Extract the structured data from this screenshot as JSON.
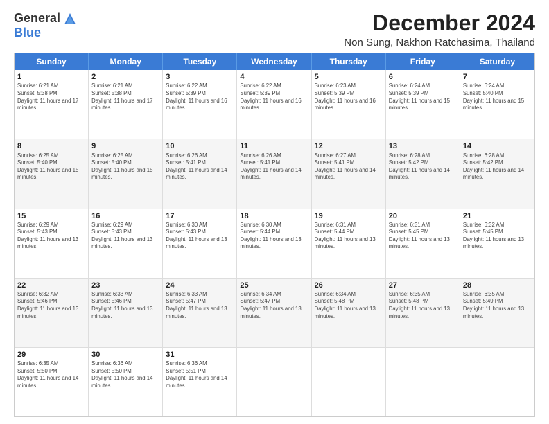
{
  "logo": {
    "general": "General",
    "blue": "Blue"
  },
  "title": "December 2024",
  "location": "Non Sung, Nakhon Ratchasima, Thailand",
  "days_of_week": [
    "Sunday",
    "Monday",
    "Tuesday",
    "Wednesday",
    "Thursday",
    "Friday",
    "Saturday"
  ],
  "weeks": [
    [
      {
        "day": "1",
        "sunrise": "6:21 AM",
        "sunset": "5:38 PM",
        "daylight": "11 hours and 17 minutes."
      },
      {
        "day": "2",
        "sunrise": "6:21 AM",
        "sunset": "5:38 PM",
        "daylight": "11 hours and 17 minutes."
      },
      {
        "day": "3",
        "sunrise": "6:22 AM",
        "sunset": "5:39 PM",
        "daylight": "11 hours and 16 minutes."
      },
      {
        "day": "4",
        "sunrise": "6:22 AM",
        "sunset": "5:39 PM",
        "daylight": "11 hours and 16 minutes."
      },
      {
        "day": "5",
        "sunrise": "6:23 AM",
        "sunset": "5:39 PM",
        "daylight": "11 hours and 16 minutes."
      },
      {
        "day": "6",
        "sunrise": "6:24 AM",
        "sunset": "5:39 PM",
        "daylight": "11 hours and 15 minutes."
      },
      {
        "day": "7",
        "sunrise": "6:24 AM",
        "sunset": "5:40 PM",
        "daylight": "11 hours and 15 minutes."
      }
    ],
    [
      {
        "day": "8",
        "sunrise": "6:25 AM",
        "sunset": "5:40 PM",
        "daylight": "11 hours and 15 minutes."
      },
      {
        "day": "9",
        "sunrise": "6:25 AM",
        "sunset": "5:40 PM",
        "daylight": "11 hours and 15 minutes."
      },
      {
        "day": "10",
        "sunrise": "6:26 AM",
        "sunset": "5:41 PM",
        "daylight": "11 hours and 14 minutes."
      },
      {
        "day": "11",
        "sunrise": "6:26 AM",
        "sunset": "5:41 PM",
        "daylight": "11 hours and 14 minutes."
      },
      {
        "day": "12",
        "sunrise": "6:27 AM",
        "sunset": "5:41 PM",
        "daylight": "11 hours and 14 minutes."
      },
      {
        "day": "13",
        "sunrise": "6:28 AM",
        "sunset": "5:42 PM",
        "daylight": "11 hours and 14 minutes."
      },
      {
        "day": "14",
        "sunrise": "6:28 AM",
        "sunset": "5:42 PM",
        "daylight": "11 hours and 14 minutes."
      }
    ],
    [
      {
        "day": "15",
        "sunrise": "6:29 AM",
        "sunset": "5:43 PM",
        "daylight": "11 hours and 13 minutes."
      },
      {
        "day": "16",
        "sunrise": "6:29 AM",
        "sunset": "5:43 PM",
        "daylight": "11 hours and 13 minutes."
      },
      {
        "day": "17",
        "sunrise": "6:30 AM",
        "sunset": "5:43 PM",
        "daylight": "11 hours and 13 minutes."
      },
      {
        "day": "18",
        "sunrise": "6:30 AM",
        "sunset": "5:44 PM",
        "daylight": "11 hours and 13 minutes."
      },
      {
        "day": "19",
        "sunrise": "6:31 AM",
        "sunset": "5:44 PM",
        "daylight": "11 hours and 13 minutes."
      },
      {
        "day": "20",
        "sunrise": "6:31 AM",
        "sunset": "5:45 PM",
        "daylight": "11 hours and 13 minutes."
      },
      {
        "day": "21",
        "sunrise": "6:32 AM",
        "sunset": "5:45 PM",
        "daylight": "11 hours and 13 minutes."
      }
    ],
    [
      {
        "day": "22",
        "sunrise": "6:32 AM",
        "sunset": "5:46 PM",
        "daylight": "11 hours and 13 minutes."
      },
      {
        "day": "23",
        "sunrise": "6:33 AM",
        "sunset": "5:46 PM",
        "daylight": "11 hours and 13 minutes."
      },
      {
        "day": "24",
        "sunrise": "6:33 AM",
        "sunset": "5:47 PM",
        "daylight": "11 hours and 13 minutes."
      },
      {
        "day": "25",
        "sunrise": "6:34 AM",
        "sunset": "5:47 PM",
        "daylight": "11 hours and 13 minutes."
      },
      {
        "day": "26",
        "sunrise": "6:34 AM",
        "sunset": "5:48 PM",
        "daylight": "11 hours and 13 minutes."
      },
      {
        "day": "27",
        "sunrise": "6:35 AM",
        "sunset": "5:48 PM",
        "daylight": "11 hours and 13 minutes."
      },
      {
        "day": "28",
        "sunrise": "6:35 AM",
        "sunset": "5:49 PM",
        "daylight": "11 hours and 13 minutes."
      }
    ],
    [
      {
        "day": "29",
        "sunrise": "6:35 AM",
        "sunset": "5:50 PM",
        "daylight": "11 hours and 14 minutes."
      },
      {
        "day": "30",
        "sunrise": "6:36 AM",
        "sunset": "5:50 PM",
        "daylight": "11 hours and 14 minutes."
      },
      {
        "day": "31",
        "sunrise": "6:36 AM",
        "sunset": "5:51 PM",
        "daylight": "11 hours and 14 minutes."
      },
      null,
      null,
      null,
      null
    ]
  ]
}
